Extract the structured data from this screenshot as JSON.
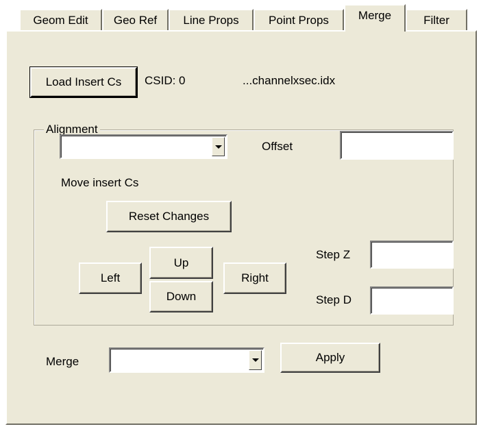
{
  "tabs": [
    {
      "label": "Geom Edit"
    },
    {
      "label": "Geo Ref"
    },
    {
      "label": "Line Props"
    },
    {
      "label": "Point Props"
    },
    {
      "label": "Merge"
    },
    {
      "label": "Filter"
    }
  ],
  "header": {
    "load_button": "Load Insert Cs",
    "csid_text": "CSID: 0",
    "file_text": "...channelxsec.idx"
  },
  "alignment": {
    "group_label": "Alignment",
    "combo_value": "",
    "offset_label": "Offset",
    "offset_value": "",
    "move_label": "Move insert Cs",
    "reset_button": "Reset Changes",
    "left_button": "Left",
    "up_button": "Up",
    "down_button": "Down",
    "right_button": "Right",
    "stepz_label": "Step Z",
    "stepz_value": "",
    "stepd_label": "Step D",
    "stepd_value": ""
  },
  "merge": {
    "label": "Merge",
    "combo_value": "",
    "apply_button": "Apply"
  }
}
